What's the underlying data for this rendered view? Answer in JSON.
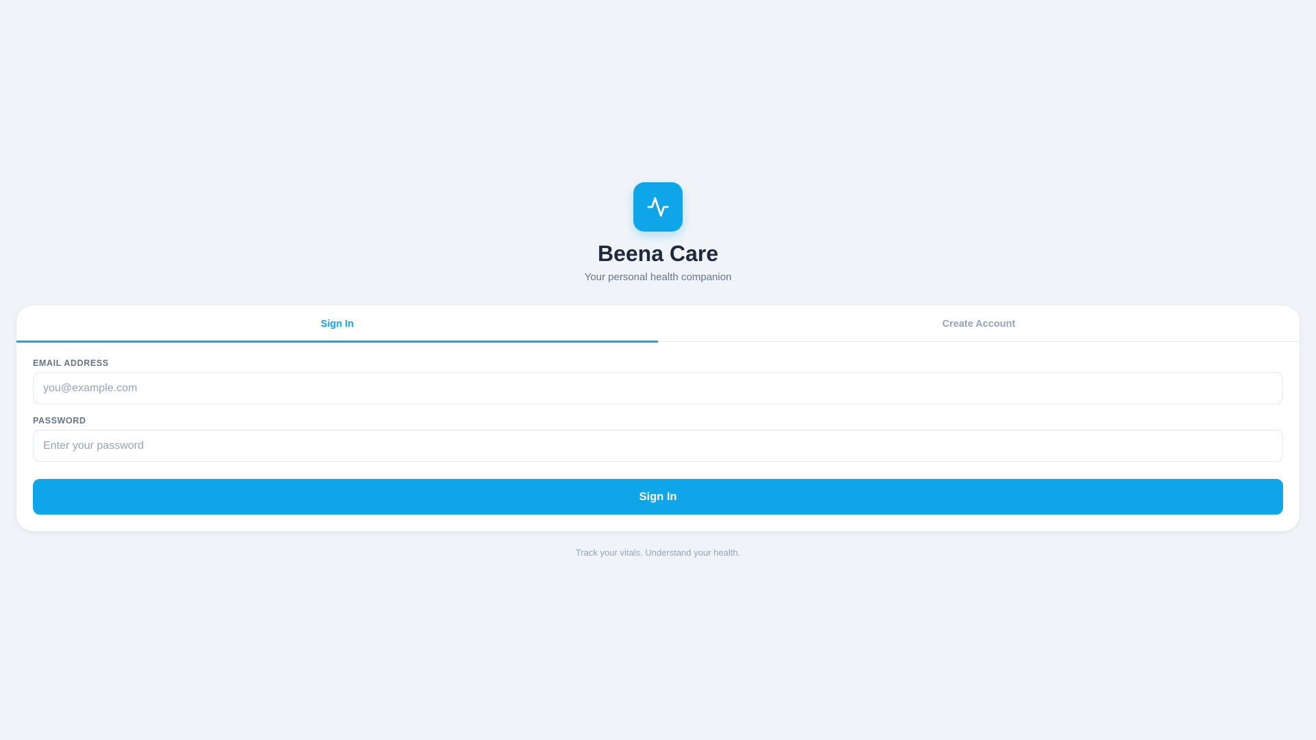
{
  "brand": {
    "name": "Beena Care",
    "tagline": "Your personal health companion",
    "icon": "activity-icon",
    "accent_color": "#0ea5e9"
  },
  "tabs": [
    {
      "label": "Sign In",
      "active": true
    },
    {
      "label": "Create Account",
      "active": false
    }
  ],
  "form": {
    "email": {
      "label": "EMAIL ADDRESS",
      "value": "",
      "placeholder": "you@example.com"
    },
    "password": {
      "label": "PASSWORD",
      "value": "",
      "placeholder": "Enter your password"
    },
    "submit_label": "Sign In"
  },
  "footer": {
    "text": "Track your vitals. Understand your health."
  }
}
